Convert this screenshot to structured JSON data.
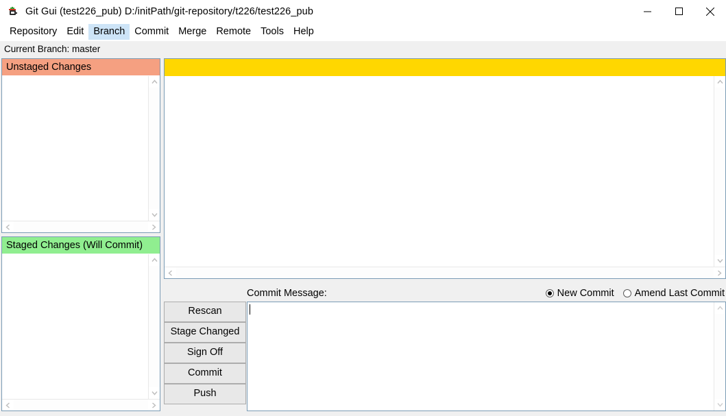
{
  "window": {
    "title": "Git Gui (test226_pub) D:/initPath/git-repository/t226/test226_pub",
    "icon": "git-gui-icon",
    "controls": {
      "minimize": "minimize-icon",
      "maximize": "maximize-icon",
      "close": "close-icon"
    }
  },
  "menubar": {
    "items": [
      {
        "label": "Repository",
        "active": false
      },
      {
        "label": "Edit",
        "active": false
      },
      {
        "label": "Branch",
        "active": true
      },
      {
        "label": "Commit",
        "active": false
      },
      {
        "label": "Merge",
        "active": false
      },
      {
        "label": "Remote",
        "active": false
      },
      {
        "label": "Tools",
        "active": false
      },
      {
        "label": "Help",
        "active": false
      }
    ]
  },
  "branchbar": {
    "text": "Current Branch: master"
  },
  "unstaged": {
    "header": "Unstaged Changes",
    "header_color": "#f5a081",
    "items": []
  },
  "staged": {
    "header": "Staged Changes (Will Commit)",
    "header_color": "#90ee90",
    "items": []
  },
  "diff": {
    "file_header": "",
    "file_header_color": "#ffd700",
    "content": ""
  },
  "commit": {
    "label": "Commit Message:",
    "message_value": "",
    "radios": [
      {
        "label": "New Commit",
        "checked": true
      },
      {
        "label": "Amend Last Commit",
        "checked": false
      }
    ]
  },
  "buttons": [
    {
      "label": "Rescan"
    },
    {
      "label": "Stage Changed"
    },
    {
      "label": "Sign Off"
    },
    {
      "label": "Commit"
    },
    {
      "label": "Push"
    }
  ],
  "statusbar": {
    "text": ""
  }
}
